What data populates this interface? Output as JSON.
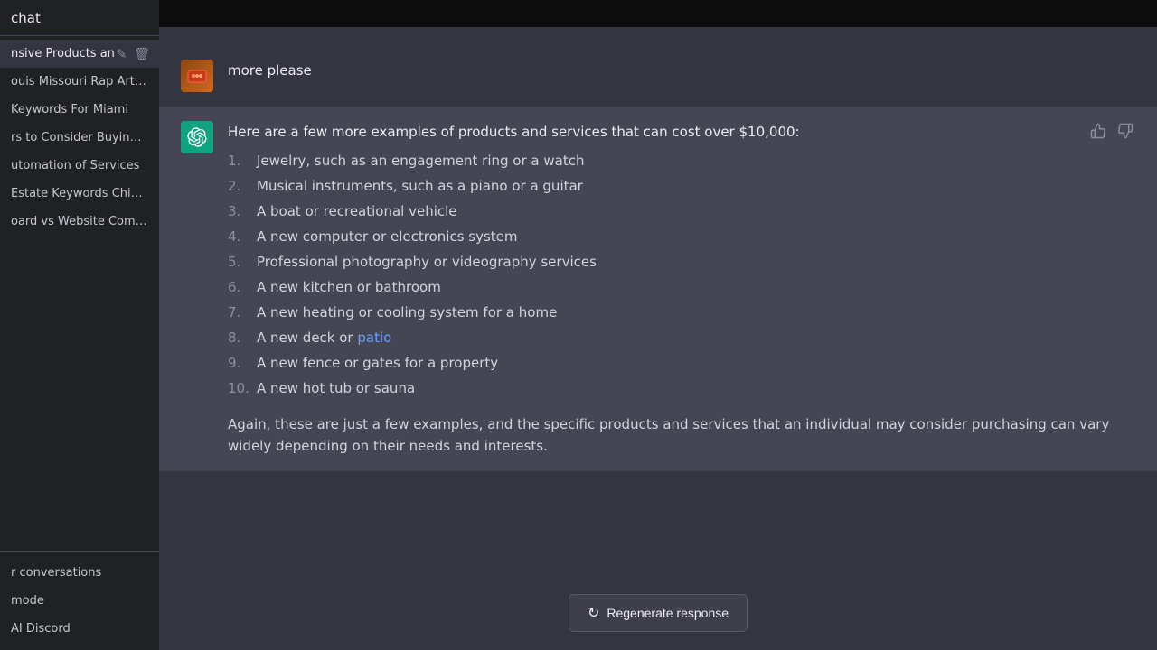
{
  "sidebar": {
    "header": {
      "title": "chat"
    },
    "items": [
      {
        "id": "item-1",
        "label": "nsive Products an",
        "active": true
      },
      {
        "id": "item-2",
        "label": "ouis Missouri Rap Artists"
      },
      {
        "id": "item-3",
        "label": "Keywords For Miami"
      },
      {
        "id": "item-4",
        "label": "rs to Consider Buying S"
      },
      {
        "id": "item-5",
        "label": "utomation of Services"
      },
      {
        "id": "item-6",
        "label": "Estate Keywords Chicag"
      },
      {
        "id": "item-7",
        "label": "oard vs Website Compar"
      }
    ],
    "bottom": [
      {
        "id": "clear-conversations",
        "label": "r conversations"
      },
      {
        "id": "dark-mode",
        "label": "mode"
      },
      {
        "id": "ai-discord",
        "label": "AI Discord"
      }
    ]
  },
  "chat": {
    "user_message": {
      "text": "more please",
      "avatar_emoji": "🎮"
    },
    "assistant_message": {
      "intro": "Here are a few more examples of products and services that can cost over $10,000:",
      "items": [
        {
          "number": "1.",
          "text": "Jewelry, such as an engagement ring or a watch"
        },
        {
          "number": "2.",
          "text": "Musical instruments, such as a piano or a guitar"
        },
        {
          "number": "3.",
          "text": "A boat or recreational vehicle"
        },
        {
          "number": "4.",
          "text": "A new computer or electronics system"
        },
        {
          "number": "5.",
          "text": "Professional photography or videography services"
        },
        {
          "number": "6.",
          "text": "A new kitchen or bathroom"
        },
        {
          "number": "7.",
          "text": "A new heating or cooling system for a home"
        },
        {
          "number": "8.",
          "text": "A new deck or ",
          "link": "patio",
          "after": ""
        },
        {
          "number": "9.",
          "text": "A new fence or gates for a property"
        },
        {
          "number": "10.",
          "text": "A new hot tub or sauna"
        }
      ],
      "closing": "Again, these are just a few examples, and the specific products and services that an individual may consider purchasing can vary widely depending on their needs and interests."
    }
  },
  "footer": {
    "regenerate_label": "Regenerate response",
    "regenerate_icon": "↺"
  },
  "icons": {
    "thumbs_up": "👍",
    "thumbs_down": "👎",
    "edit": "✏",
    "delete": "🗑",
    "gpt_symbol": "✦"
  }
}
